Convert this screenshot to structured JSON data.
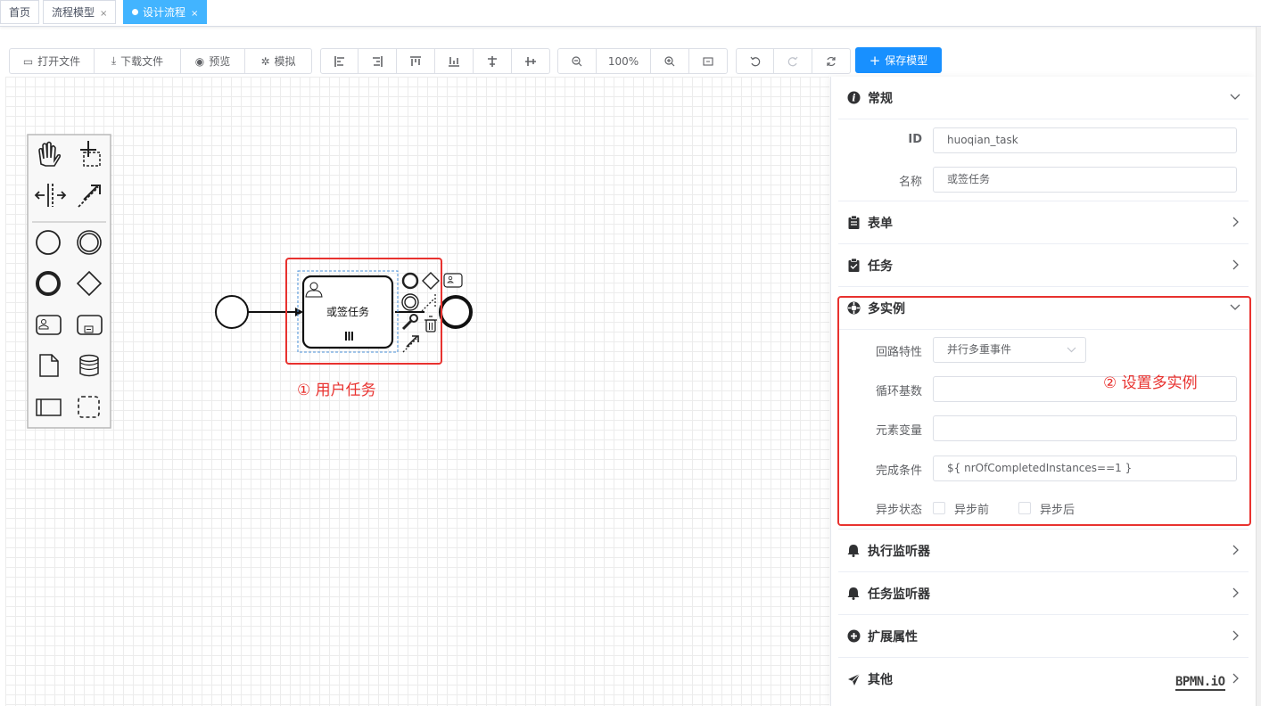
{
  "tabs": [
    {
      "label": "首页",
      "close": ""
    },
    {
      "label": "流程模型",
      "close": "×"
    },
    {
      "label": "设计流程",
      "close": "×"
    }
  ],
  "toolbar": {
    "file": {
      "open": "打开文件",
      "download": "下载文件",
      "preview": "预览",
      "simulate": "模拟"
    },
    "zoom_level": "100%",
    "save": "保存模型"
  },
  "diagram": {
    "task_label": "或签任务",
    "annotation_1": "① 用户任务",
    "annotation_2": "② 设置多实例"
  },
  "panel": {
    "general": {
      "title": "常规",
      "id_label": "ID",
      "id_value": "huoqian_task",
      "name_label": "名称",
      "name_value": "或签任务"
    },
    "form": {
      "title": "表单"
    },
    "task": {
      "title": "任务"
    },
    "multi_instance": {
      "title": "多实例",
      "loop_label": "回路特性",
      "loop_value": "并行多重事件",
      "cardinality_label": "循环基数",
      "cardinality_value": "",
      "element_var_label": "元素变量",
      "element_var_value": "",
      "completion_label": "完成条件",
      "completion_value": "${ nrOfCompletedInstances==1 }",
      "async_label": "异步状态",
      "async_before": "异步前",
      "async_after": "异步后"
    },
    "exec_listener": {
      "title": "执行监听器"
    },
    "task_listener": {
      "title": "任务监听器"
    },
    "extension": {
      "title": "扩展属性"
    },
    "other": {
      "title": "其他"
    }
  },
  "watermark": "BPMN.iO",
  "colors": {
    "accent": "#1890ff",
    "tab_active": "#42b4ff",
    "annotation": "#e8322f"
  }
}
